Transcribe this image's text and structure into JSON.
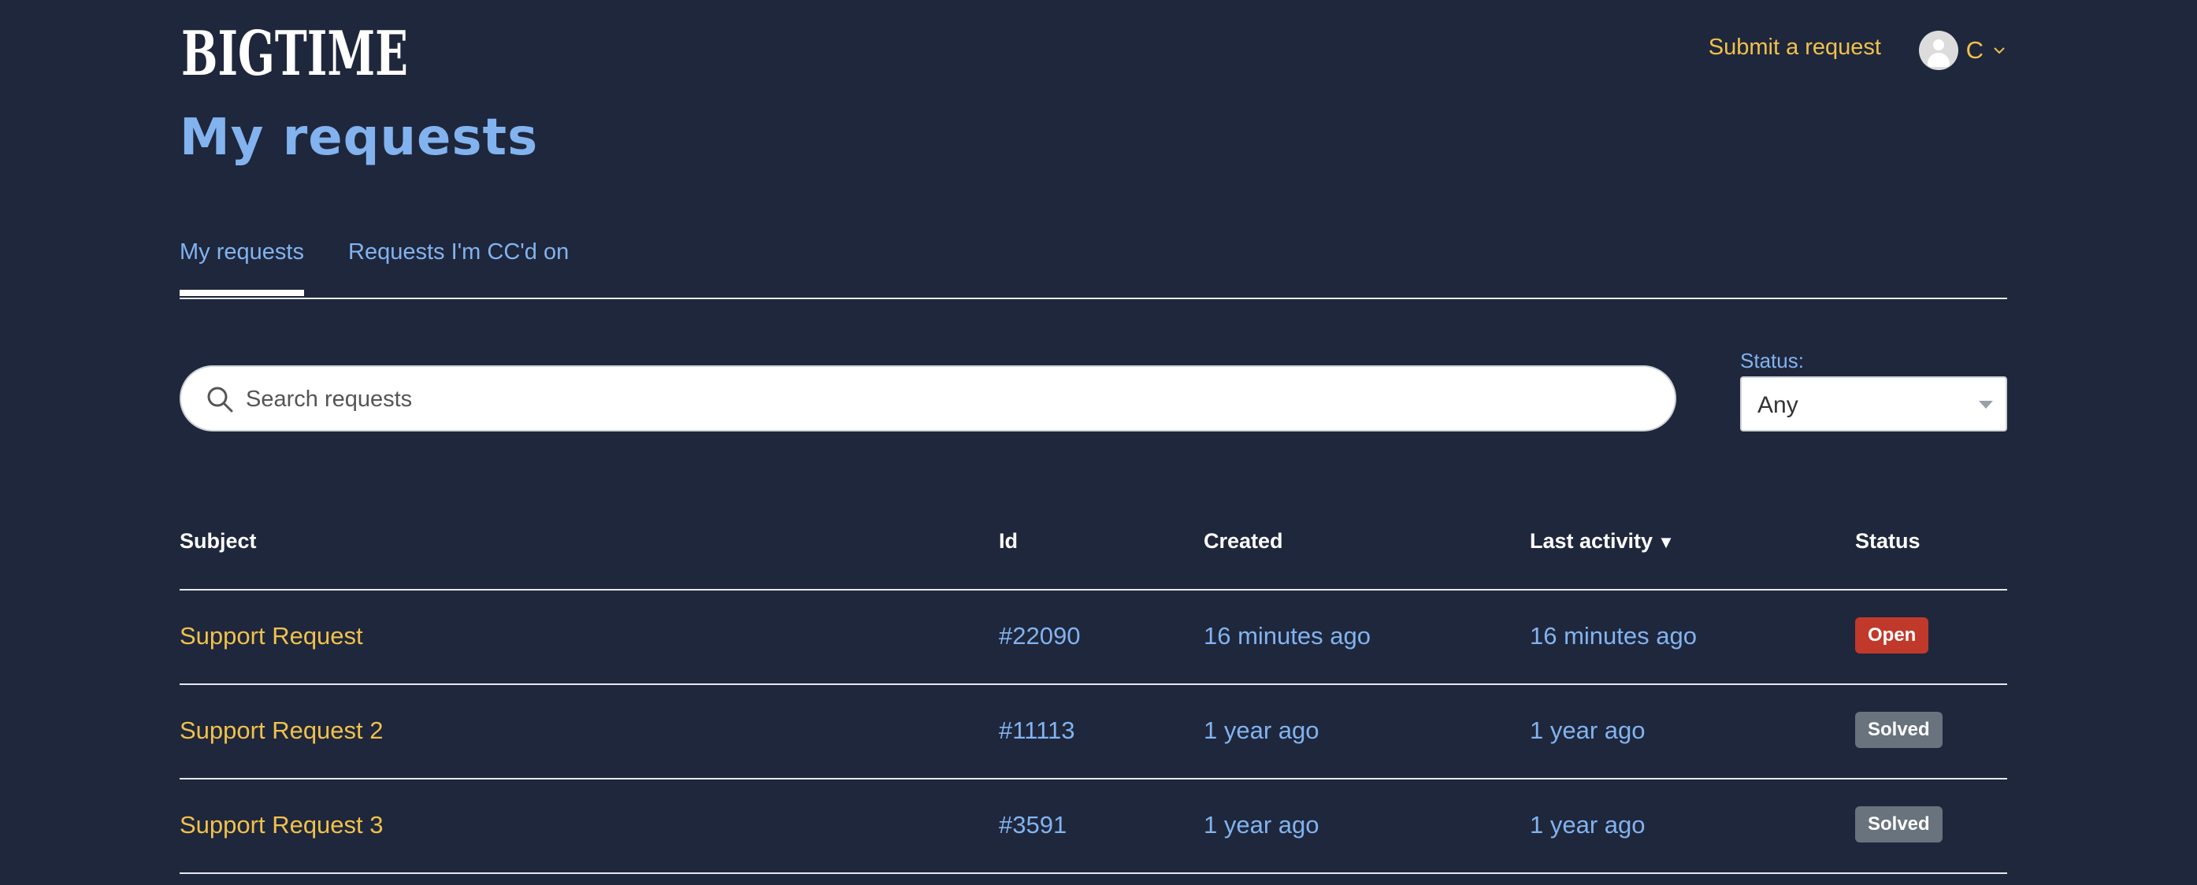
{
  "header": {
    "logo_text": "BIGTIME",
    "submit_request": "Submit a request",
    "user_initial": "C"
  },
  "page_title": "My requests",
  "tabs": [
    {
      "label": "My requests",
      "active": true
    },
    {
      "label": "Requests I'm CC'd on",
      "active": false
    }
  ],
  "search": {
    "placeholder": "Search requests",
    "value": ""
  },
  "status_filter": {
    "label": "Status:",
    "selected": "Any"
  },
  "table": {
    "columns": [
      "Subject",
      "Id",
      "Created",
      "Last activity",
      "Status"
    ],
    "sort_indicator": "▼",
    "rows": [
      {
        "subject": "Support Request",
        "id": "#22090",
        "created": "16 minutes ago",
        "last_activity": "16 minutes ago",
        "status": "Open"
      },
      {
        "subject": "Support Request 2",
        "id": "#11113",
        "created": "1 year ago",
        "last_activity": "1 year ago",
        "status": "Solved"
      },
      {
        "subject": "Support Request 3",
        "id": "#3591",
        "created": "1 year ago",
        "last_activity": "1 year ago",
        "status": "Solved"
      }
    ]
  },
  "colors": {
    "background": "#1f273c",
    "link_yellow": "#f0c14b",
    "link_blue": "#82b3ef",
    "status_open": "#c0392b",
    "status_solved": "#68737d"
  }
}
